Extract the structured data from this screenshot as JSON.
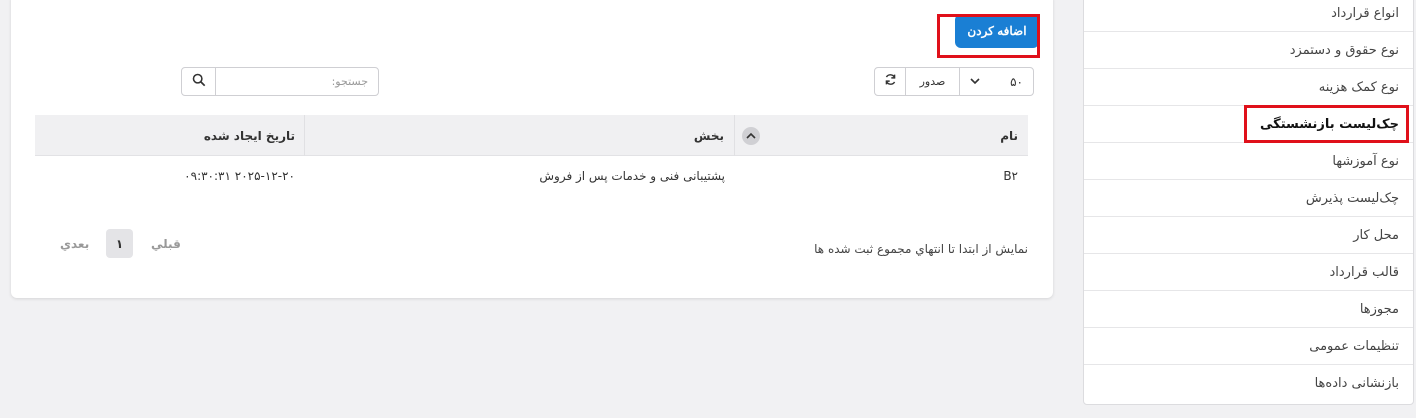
{
  "sidebar": {
    "items": [
      {
        "label": "انواع قرارداد"
      },
      {
        "label": "نوع حقوق و دستمزد"
      },
      {
        "label": "نوع کمک هزینه"
      },
      {
        "label": "چک‌لیست بازنشستگی",
        "active": true
      },
      {
        "label": "نوع آموزشها"
      },
      {
        "label": "چک‌لیست پذیرش"
      },
      {
        "label": "محل کار"
      },
      {
        "label": "قالب قرارداد"
      },
      {
        "label": "مجوزها"
      },
      {
        "label": "تنظیمات عمومی"
      },
      {
        "label": "بازنشانی داده‌ها"
      }
    ]
  },
  "main": {
    "add_button": "اضافه کردن",
    "toolbar": {
      "length_value": "۵۰",
      "export_label": "صدور",
      "search_placeholder": "جستجو:"
    },
    "table": {
      "headers": [
        "نام",
        "بخش",
        "تاریخ ایجاد شده"
      ],
      "rows": [
        {
          "name": "B۲",
          "section": "پشتیبانی فنی و خدمات پس از فروش",
          "created": "۲۰۲۵-۱۲-۲۰ ۰۹:۳۰:۳۱"
        }
      ]
    },
    "footer": {
      "info": "نمایش از ابتدا تا انتهاي مجموع ثبت شده ها",
      "prev": "قبلي",
      "page": "۱",
      "next": "بعدي"
    }
  },
  "colors": {
    "primary": "#1a7fd4",
    "highlight": "#e0101a",
    "background": "#f1f1f3"
  }
}
